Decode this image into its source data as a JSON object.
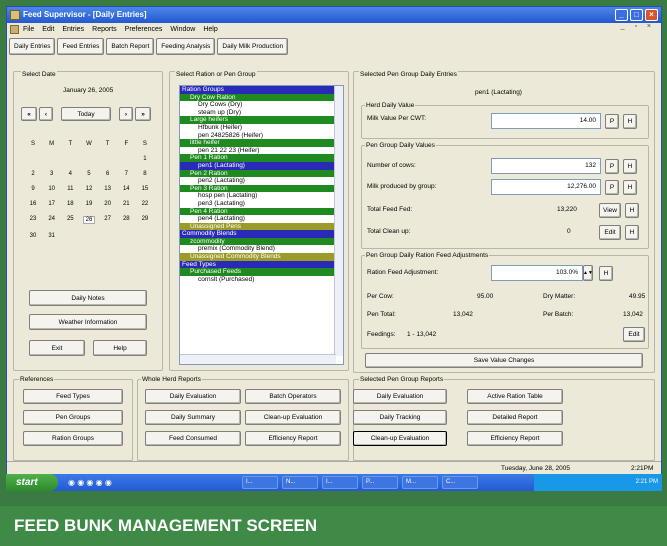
{
  "window": {
    "title": "Feed Supervisor - [Daily Entries]"
  },
  "menu": [
    "File",
    "Edit",
    "Entries",
    "Reports",
    "Preferences",
    "Window",
    "Help"
  ],
  "toolbar": [
    "Daily Entries",
    "Feed Entries",
    "Batch Report",
    "Feeding Analysis",
    "Daily Milk Production"
  ],
  "date_panel": {
    "label": "Select Date",
    "date": "January 26, 2005",
    "today_btn": "Today",
    "prev_year": "«",
    "prev": "‹",
    "next": "›",
    "next_year": "»",
    "weekdays": [
      "S",
      "M",
      "T",
      "W",
      "T",
      "F",
      "S"
    ],
    "weeks": [
      [
        "",
        "",
        "",
        "",
        "",
        "",
        "1"
      ],
      [
        "2",
        "3",
        "4",
        "5",
        "6",
        "7",
        "8"
      ],
      [
        "9",
        "10",
        "11",
        "12",
        "13",
        "14",
        "15"
      ],
      [
        "16",
        "17",
        "18",
        "19",
        "20",
        "21",
        "22"
      ],
      [
        "23",
        "24",
        "25",
        "26",
        "27",
        "28",
        "29"
      ],
      [
        "30",
        "31",
        "",
        "",
        "",
        "",
        ""
      ]
    ],
    "daily_notes": "Daily Notes",
    "weather": "Weather Information",
    "exit": "Exit",
    "help": "Help"
  },
  "ration_panel": {
    "label": "Select Ration or Pen Group",
    "rows": [
      {
        "t": "Ration Groups",
        "k": "blue"
      },
      {
        "t": "Dry Cow Ration",
        "k": "green"
      },
      {
        "t": "Dry Cows (Dry)",
        "k": "item"
      },
      {
        "t": "steam up (Dry)",
        "k": "item"
      },
      {
        "t": "Large heifers",
        "k": "green"
      },
      {
        "t": "Hfbunk (Heifer)",
        "k": "item"
      },
      {
        "t": "pen 24825826 (Heifer)",
        "k": "item"
      },
      {
        "t": "little heifer",
        "k": "green"
      },
      {
        "t": "pen 21 22 23 (Heifer)",
        "k": "item"
      },
      {
        "t": "Pen 1 Ration",
        "k": "green"
      },
      {
        "t": "pen1 (Lactating)",
        "k": "sel"
      },
      {
        "t": "Pen 2 Ration",
        "k": "green"
      },
      {
        "t": "pen2 (Lactating)",
        "k": "item"
      },
      {
        "t": "Pen 3 Ration",
        "k": "green"
      },
      {
        "t": "hosp pen (Lactating)",
        "k": "item"
      },
      {
        "t": "pen3 (Lactating)",
        "k": "item"
      },
      {
        "t": "Pen 4 Ration",
        "k": "green"
      },
      {
        "t": "pen4 (Lactating)",
        "k": "item"
      },
      {
        "t": "Unassigned Pens",
        "k": "olive"
      },
      {
        "t": "Commodity Blends",
        "k": "blue"
      },
      {
        "t": "zcommodity",
        "k": "green"
      },
      {
        "t": "premix (Commodity Blend)",
        "k": "item"
      },
      {
        "t": "Unassigned Commodity Blends",
        "k": "olive"
      },
      {
        "t": "Feed Types",
        "k": "blue"
      },
      {
        "t": "Purchased Feeds",
        "k": "green"
      },
      {
        "t": "cornslt (Purchased)",
        "k": "item"
      }
    ]
  },
  "entries": {
    "label": "Selected Pen Group Daily Entries",
    "pen": "pen1 (Lactating)",
    "herd_label": "Herd Daily Value",
    "milk_value_label": "Milk Value Per CWT:",
    "milk_value": "14.00",
    "pen_values_label": "Pen Group Daily Values",
    "cows_label": "Number of cows:",
    "cows": "132",
    "milk_label": "Milk produced by group:",
    "milk": "12,276.00",
    "total_fed_label": "Total Feed Fed:",
    "total_fed": "13,220",
    "view": "View",
    "cleanup_label": "Total Clean up:",
    "cleanup": "0",
    "edit": "Edit",
    "p": "P",
    "h": "H",
    "adj_label": "Pen Group Daily Ration Feed Adjustments",
    "rfa_label": "Ration Feed Adjustment:",
    "rfa": "103.0%",
    "per_cow_label": "Per Cow:",
    "per_cow": "95.00",
    "dry_matter_label": "Dry Matter:",
    "dry_matter": "49.95",
    "pen_total_label": "Pen Total:",
    "pen_total": "13,042",
    "per_batch_label": "Per Batch:",
    "per_batch": "13,042",
    "feedings_label": "Feedings:",
    "feedings": "1 - 13,042",
    "save": "Save Value Changes"
  },
  "references": {
    "label": "References",
    "buttons": [
      "Feed Types",
      "Pen Groups",
      "Ration Groups"
    ]
  },
  "herd_reports": {
    "label": "Whole Herd Reports",
    "buttons": [
      "Daily Evaluation",
      "Batch Operators",
      "Daily Summary",
      "Clean-up Evaluation",
      "Feed Consumed",
      "Efficiency Report"
    ]
  },
  "pen_reports": {
    "label": "Selected Pen Group Reports",
    "buttons": [
      "Daily Evaluation",
      "Active Ration Table",
      "Daily Tracking",
      "Detailed Report",
      "Clean-up Evaluation",
      "Efficiency Report"
    ]
  },
  "status": {
    "date": "Tuesday, June 28, 2005",
    "time": "2:21PM"
  },
  "taskbar": {
    "start": "start",
    "tasks": [
      "I...",
      "N...",
      "I...",
      "P...",
      "M...",
      "C..."
    ],
    "clock": "2:21 PM"
  },
  "caption": "FEED BUNK MANAGEMENT SCREEN"
}
